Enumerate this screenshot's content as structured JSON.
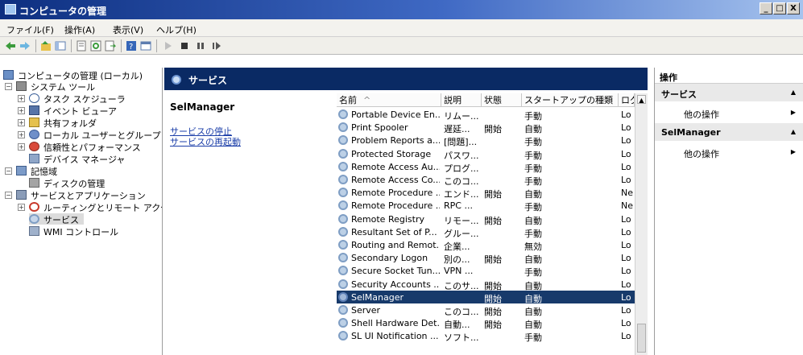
{
  "window": {
    "title": "コンピュータの管理",
    "min": "_",
    "max": "□",
    "close": "X"
  },
  "menus": [
    "ファイル(F)",
    "操作(A)",
    "表示(V)",
    "ヘルプ(H)"
  ],
  "tree": [
    {
      "label": "コンピュータの管理 (ローカル)",
      "expander": ""
    },
    {
      "label": "システム ツール",
      "expander": "⊟"
    },
    {
      "label": "タスク スケジューラ",
      "expander": "⊞"
    },
    {
      "label": "イベント ビューア",
      "expander": "⊞"
    },
    {
      "label": "共有フォルダ",
      "expander": "⊞"
    },
    {
      "label": "ローカル ユーザーとグループ",
      "expander": "⊞"
    },
    {
      "label": "信頼性とパフォーマンス",
      "expander": "⊞"
    },
    {
      "label": "デバイス マネージャ",
      "expander": ""
    },
    {
      "label": "記憶域",
      "expander": "⊟"
    },
    {
      "label": "ディスクの管理",
      "expander": ""
    },
    {
      "label": "サービスとアプリケーション",
      "expander": "⊟"
    },
    {
      "label": "ルーティングとリモート アクセス",
      "expander": "⊞"
    },
    {
      "label": "サービス",
      "expander": ""
    },
    {
      "label": "WMI コントロール",
      "expander": ""
    }
  ],
  "center": {
    "header": "サービス",
    "desc_title": "SelManager",
    "links": [
      "サービスの停止",
      "サービスの再起動"
    ]
  },
  "columns": [
    "名前",
    "説明",
    "状態",
    "スタートアップの種類",
    "ログ"
  ],
  "rows": [
    {
      "name": "Portable Device En...",
      "desc": "リムー...",
      "status": "",
      "startup": "手動",
      "logon": "Lo"
    },
    {
      "name": "Print Spooler",
      "desc": "遅延...",
      "status": "開始",
      "startup": "自動",
      "logon": "Lo"
    },
    {
      "name": "Problem Reports a...",
      "desc": "[問題]...",
      "status": "",
      "startup": "手動",
      "logon": "Lo"
    },
    {
      "name": "Protected Storage",
      "desc": "パスワ...",
      "status": "",
      "startup": "手動",
      "logon": "Lo"
    },
    {
      "name": "Remote Access Au...",
      "desc": "プログ...",
      "status": "",
      "startup": "手動",
      "logon": "Lo"
    },
    {
      "name": "Remote Access Co...",
      "desc": "このコ...",
      "status": "",
      "startup": "手動",
      "logon": "Lo"
    },
    {
      "name": "Remote Procedure ...",
      "desc": "エンド...",
      "status": "開始",
      "startup": "自動",
      "logon": "Ne"
    },
    {
      "name": "Remote Procedure ...",
      "desc": "RPC ...",
      "status": "",
      "startup": "手動",
      "logon": "Ne"
    },
    {
      "name": "Remote Registry",
      "desc": "リモー...",
      "status": "開始",
      "startup": "自動",
      "logon": "Lo"
    },
    {
      "name": "Resultant Set of P...",
      "desc": "グルー...",
      "status": "",
      "startup": "手動",
      "logon": "Lo"
    },
    {
      "name": "Routing and Remot...",
      "desc": "企業...",
      "status": "",
      "startup": "無効",
      "logon": "Lo"
    },
    {
      "name": "Secondary Logon",
      "desc": "別の...",
      "status": "開始",
      "startup": "自動",
      "logon": "Lo"
    },
    {
      "name": "Secure Socket Tun...",
      "desc": "VPN ...",
      "status": "",
      "startup": "手動",
      "logon": "Lo"
    },
    {
      "name": "Security Accounts ...",
      "desc": "このサ...",
      "status": "開始",
      "startup": "自動",
      "logon": "Lo"
    },
    {
      "name": "SelManager",
      "desc": "",
      "status": "開始",
      "startup": "自動",
      "logon": "Lo",
      "selected": true
    },
    {
      "name": "Server",
      "desc": "このコ...",
      "status": "開始",
      "startup": "自動",
      "logon": "Lo"
    },
    {
      "name": "Shell Hardware Det...",
      "desc": "自動...",
      "status": "開始",
      "startup": "自動",
      "logon": "Lo"
    },
    {
      "name": "SL UI Notification ...",
      "desc": "ソフト...",
      "status": "",
      "startup": "手動",
      "logon": "Lo"
    }
  ],
  "actions": {
    "header": "操作",
    "groups": [
      {
        "title": "サービス",
        "item": "他の操作"
      },
      {
        "title": "SelManager",
        "item": "他の操作"
      }
    ]
  },
  "colors": {
    "title_start": "#0d2f80",
    "header_bg": "#0a2a64",
    "selection": "#173a6b",
    "link": "#1a3da8"
  }
}
